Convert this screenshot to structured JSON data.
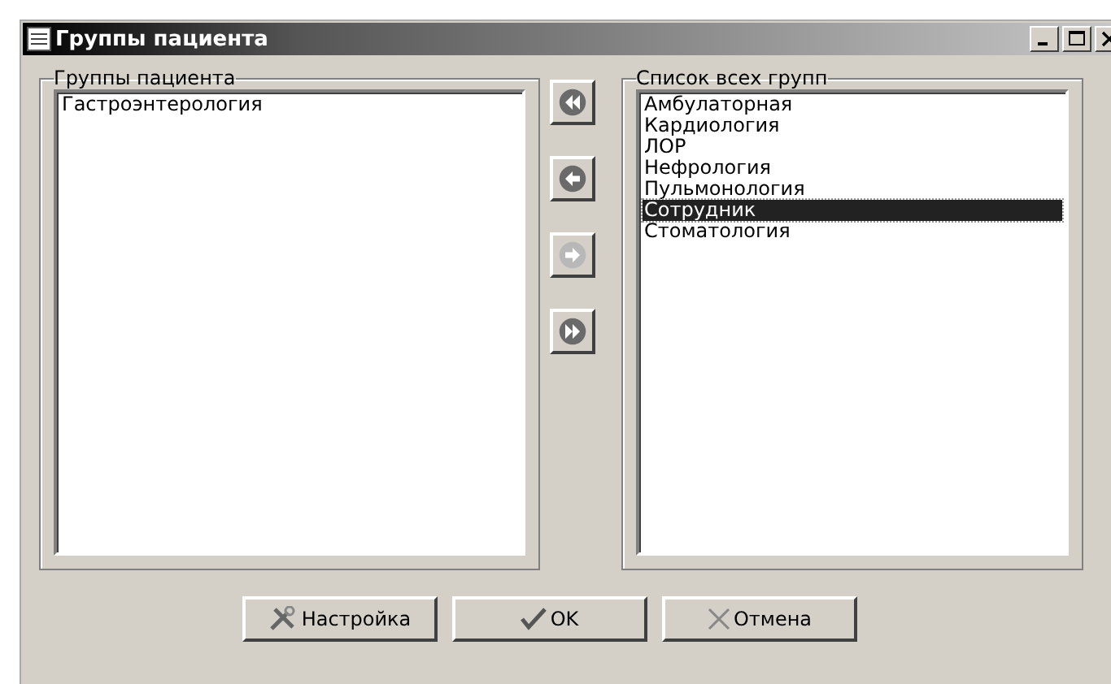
{
  "window": {
    "title": "Группы пациента"
  },
  "patient_groups": {
    "label": "Группы пациента",
    "items": [
      {
        "text": "Гастроэнтерология",
        "selected": false
      }
    ]
  },
  "move_buttons": [
    {
      "kind": "all-left",
      "disabled": false
    },
    {
      "kind": "left",
      "disabled": false
    },
    {
      "kind": "right",
      "disabled": true
    },
    {
      "kind": "all-right",
      "disabled": false
    }
  ],
  "all_groups": {
    "label": "Список всех групп",
    "items": [
      {
        "text": "Амбулаторная",
        "selected": false
      },
      {
        "text": "Кардиология",
        "selected": false
      },
      {
        "text": "ЛОР",
        "selected": false
      },
      {
        "text": "Нефрология",
        "selected": false
      },
      {
        "text": "Пульмонология",
        "selected": false
      },
      {
        "text": "Сотрудник",
        "selected": true
      },
      {
        "text": "Стоматология",
        "selected": false
      }
    ]
  },
  "buttons": [
    {
      "kind": "settings",
      "label": "Настройка"
    },
    {
      "kind": "ok",
      "label": "OK"
    },
    {
      "kind": "cancel",
      "label": "Отмена"
    }
  ]
}
